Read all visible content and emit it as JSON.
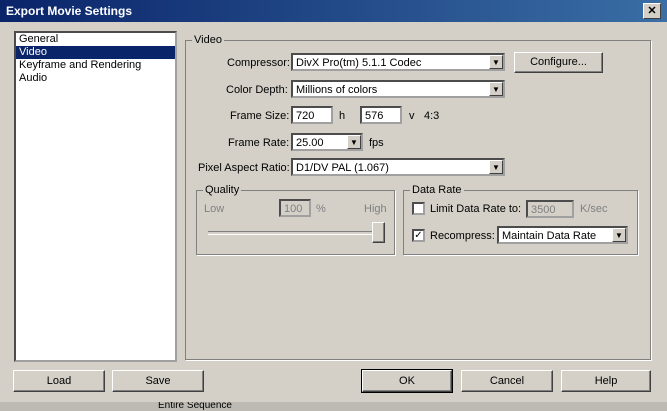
{
  "window": {
    "title": "Export Movie Settings",
    "close_glyph": "✕"
  },
  "sidebar": {
    "items": [
      {
        "label": "General"
      },
      {
        "label": "Video"
      },
      {
        "label": "Keyframe and Rendering"
      },
      {
        "label": "Audio"
      }
    ],
    "selected": "Video"
  },
  "video": {
    "group_title": "Video",
    "compressor_label": "Compressor:",
    "compressor_value": "DivX Pro(tm) 5.1.1 Codec",
    "configure_label": "Configure...",
    "color_depth_label": "Color Depth:",
    "color_depth_value": "Millions of colors",
    "frame_size_label": "Frame Size:",
    "frame_width": "720",
    "h_label": "h",
    "frame_height": "576",
    "v_label": "v",
    "aspect": "4:3",
    "frame_rate_label": "Frame Rate:",
    "frame_rate_value": "25.00",
    "fps_label": "fps",
    "par_label": "Pixel Aspect Ratio:",
    "par_value": "D1/DV PAL (1.067)"
  },
  "quality": {
    "group_title": "Quality",
    "low_label": "Low",
    "value": "100",
    "percent_label": "%",
    "high_label": "High",
    "slider_level": 1.0
  },
  "data_rate": {
    "group_title": "Data Rate",
    "limit_label": "Limit Data Rate to:",
    "limit_checked": false,
    "limit_value": "3500",
    "unit_label": "K/sec",
    "recompress_label": "Recompress:",
    "recompress_checked": true,
    "recompress_value": "Maintain Data Rate"
  },
  "buttons": {
    "load": "Load",
    "save": "Save",
    "ok": "OK",
    "cancel": "Cancel",
    "help": "Help"
  },
  "background_text": "Entire Sequence",
  "icons": {
    "dropdown": "▼",
    "check": "✓"
  }
}
